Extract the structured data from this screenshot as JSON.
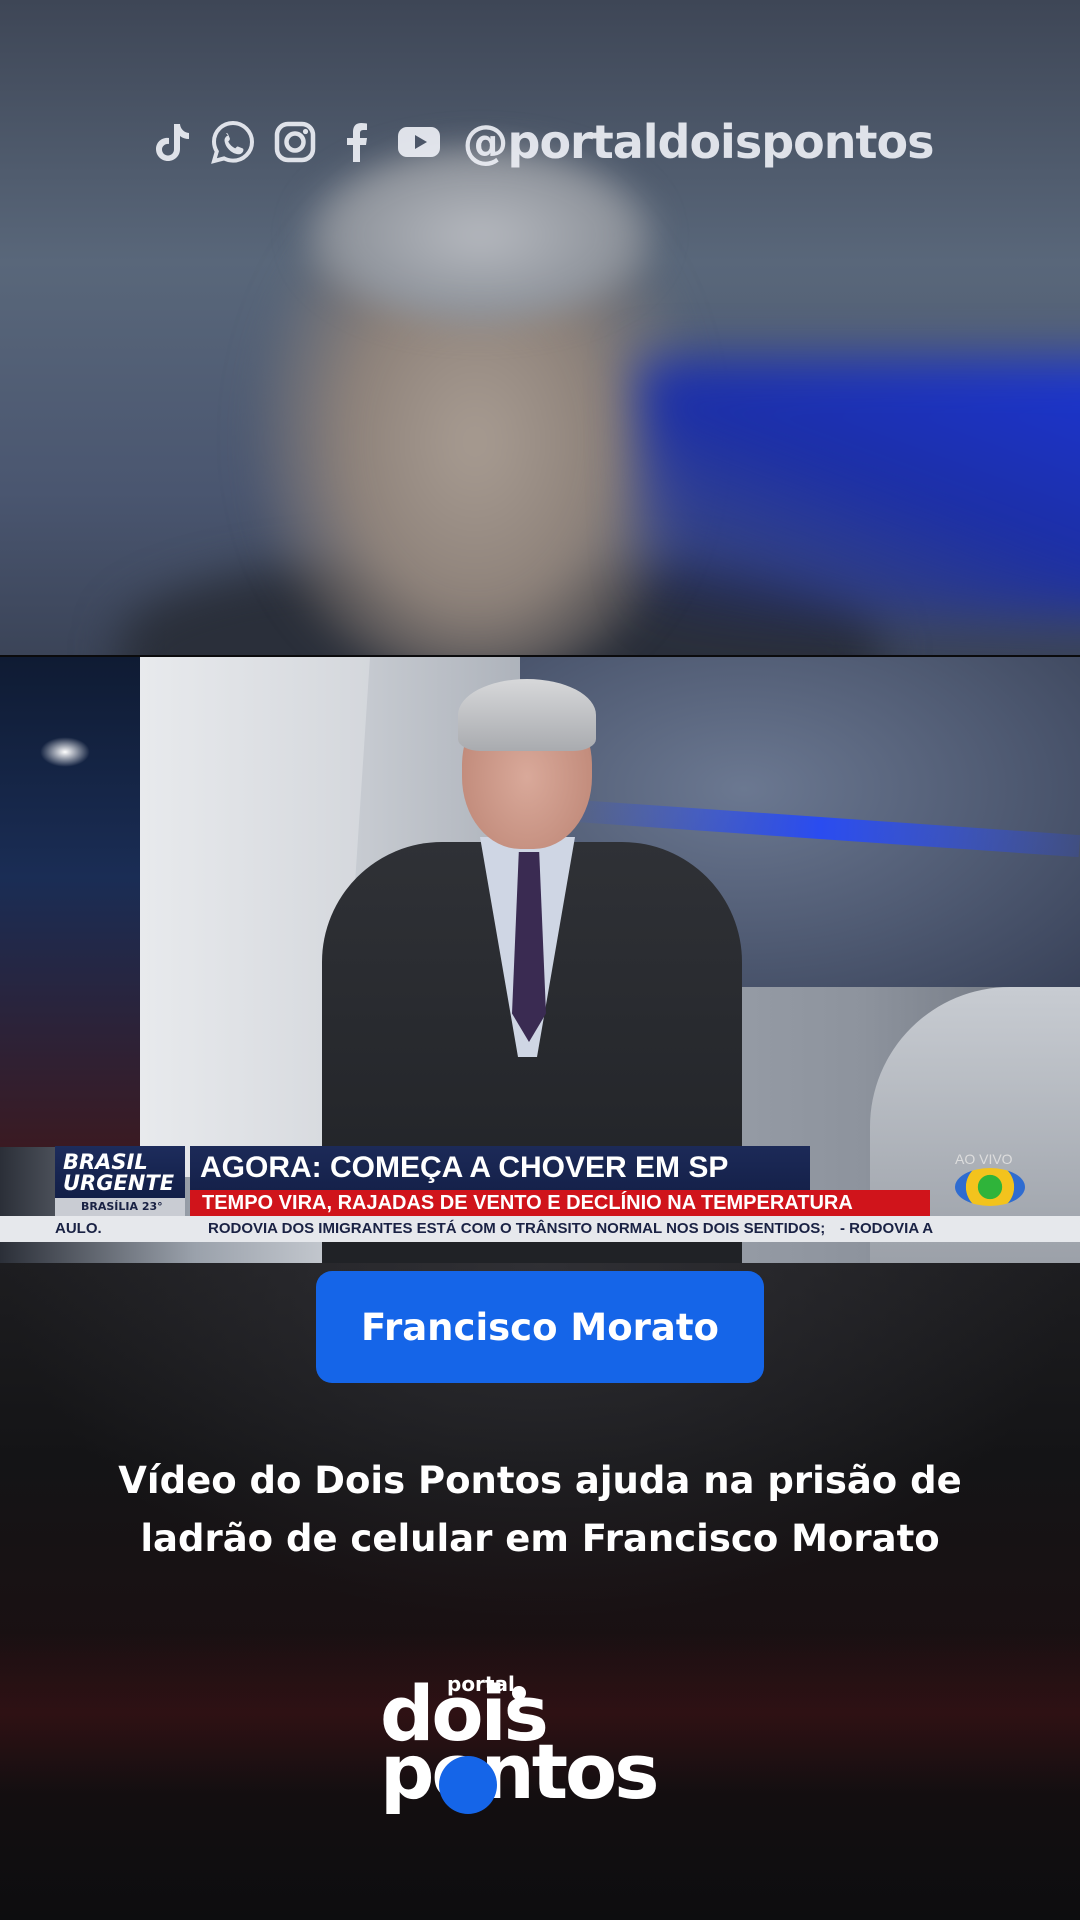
{
  "social": {
    "icons": [
      "tiktok-icon",
      "whatsapp-icon",
      "instagram-icon",
      "facebook-icon",
      "youtube-icon"
    ],
    "handle": "@portaldoispontos"
  },
  "tv_overlay": {
    "logo_line1": "BRASIL",
    "logo_line2": "URGENTE",
    "logo_city": "BRASÍLIA",
    "logo_temp": "23°",
    "headline": "AGORA: COMEÇA A CHOVER EM SP",
    "subheadline": "TEMPO VIRA, RAJADAS DE VENTO E DECLÍNIO NA TEMPERATURA",
    "ticker_left": "AULO.",
    "ticker_main": "RODOVIA DOS IMIGRANTES ESTÁ COM O TRÂNSITO NORMAL NOS DOIS SENTIDOS;",
    "ticker_right": "- RODOVIA A",
    "live_label": "AO VIVO"
  },
  "location_badge": "Francisco Morato",
  "headline": {
    "line1": "Vídeo do Dois Pontos ajuda na prisão de",
    "line2": "ladrão de celular em Francisco Morato"
  },
  "brand": {
    "small": "portal",
    "word1": "dois",
    "word2": "pontos"
  },
  "colors": {
    "accent_blue": "#1565e8",
    "tv_red": "#d0141b",
    "tv_navy": "#1c2a58"
  }
}
